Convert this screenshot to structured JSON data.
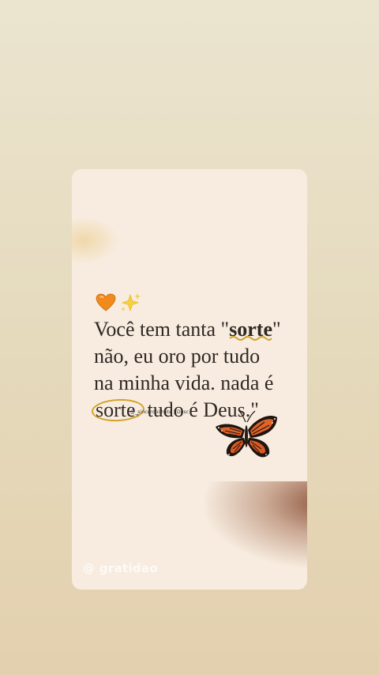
{
  "post": {
    "emoji_1": "orange-heart",
    "emoji_2": "sparkles",
    "quote": {
      "open_quote": "Você tem tanta \"",
      "word_bold": "sorte",
      "middle": "\" não, eu oro por tudo na minha vida. nada é ",
      "word_circled": "sorte.",
      "close": " tudo é Deus.\""
    },
    "credit": "@_sincerobilhete | Desc",
    "watermark": "@ gratidao"
  },
  "colors": {
    "background": "#e8ddc4",
    "card": "#f7ecdf",
    "text": "#2f2823",
    "highlight": "#d1a22b",
    "butterfly_orange": "#e0642a"
  }
}
